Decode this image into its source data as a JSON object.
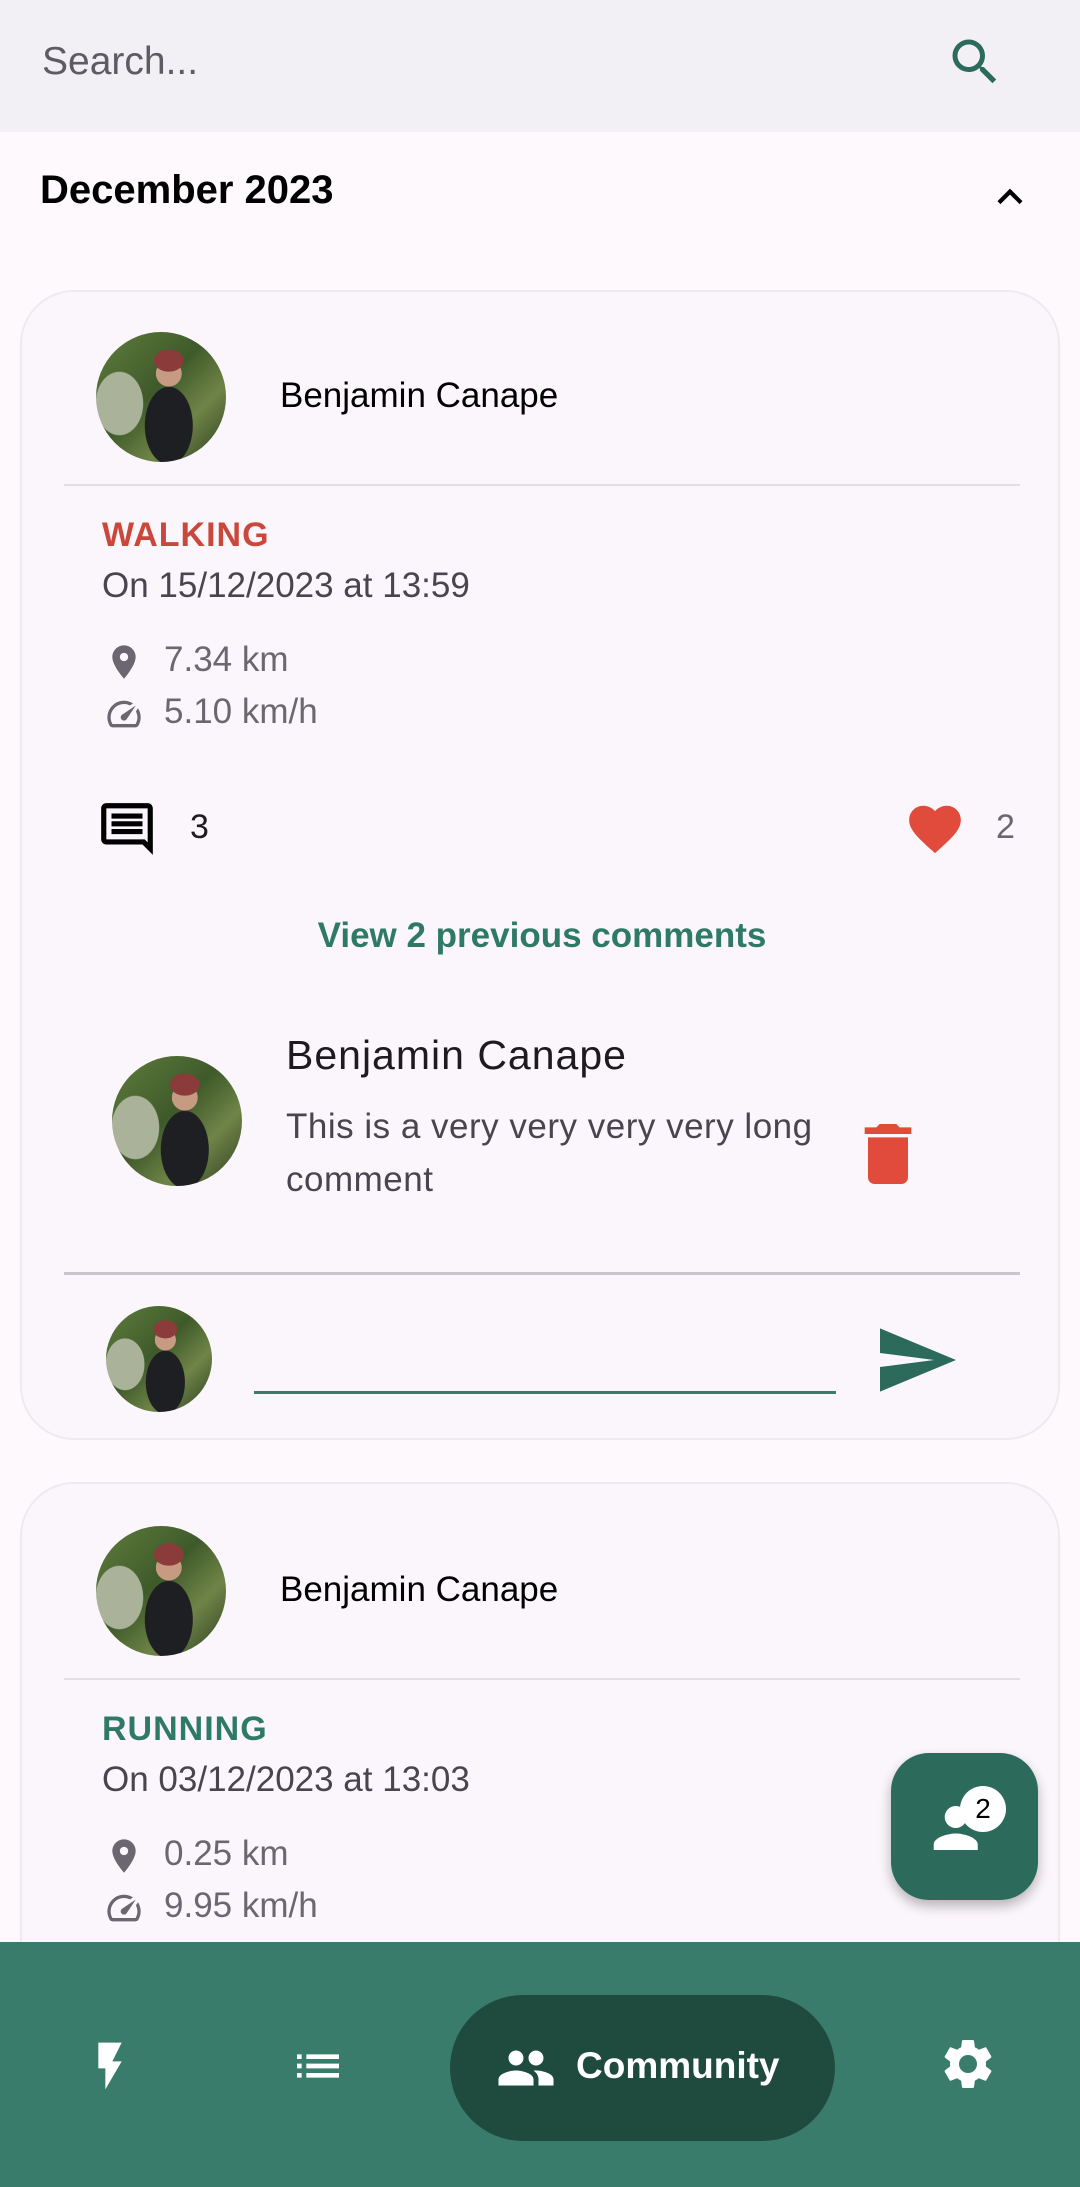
{
  "search": {
    "placeholder": "Search..."
  },
  "section": {
    "month": "December 2023"
  },
  "cards": [
    {
      "user": "Benjamin Canape",
      "activity_type": "WALKING",
      "activity_color": "#c9483b",
      "date": "On 15/12/2023 at 13:59",
      "distance": "7.34 km",
      "speed": "5.10 km/h",
      "comment_count": "3",
      "like_count": "2",
      "view_previous": "View 2 previous comments",
      "comment": {
        "author": "Benjamin Canape",
        "text": "This is a very very very very long comment"
      },
      "comment_input": {
        "value": ""
      }
    },
    {
      "user": "Benjamin Canape",
      "activity_type": "RUNNING",
      "activity_color": "#2f7a66",
      "date": "On 03/12/2023 at 13:03",
      "distance": "0.25 km",
      "speed": "9.95 km/h"
    }
  ],
  "fab": {
    "badge": "2"
  },
  "nav": {
    "items": [
      {
        "icon": "bolt-icon"
      },
      {
        "icon": "list-icon"
      },
      {
        "icon": "community-icon",
        "label": "Community"
      },
      {
        "icon": "settings-gear-icon"
      }
    ]
  },
  "colors": {
    "primary": "#3a7c6b",
    "primary_dark": "#1f4b3f",
    "accent_red": "#e04b3c"
  }
}
